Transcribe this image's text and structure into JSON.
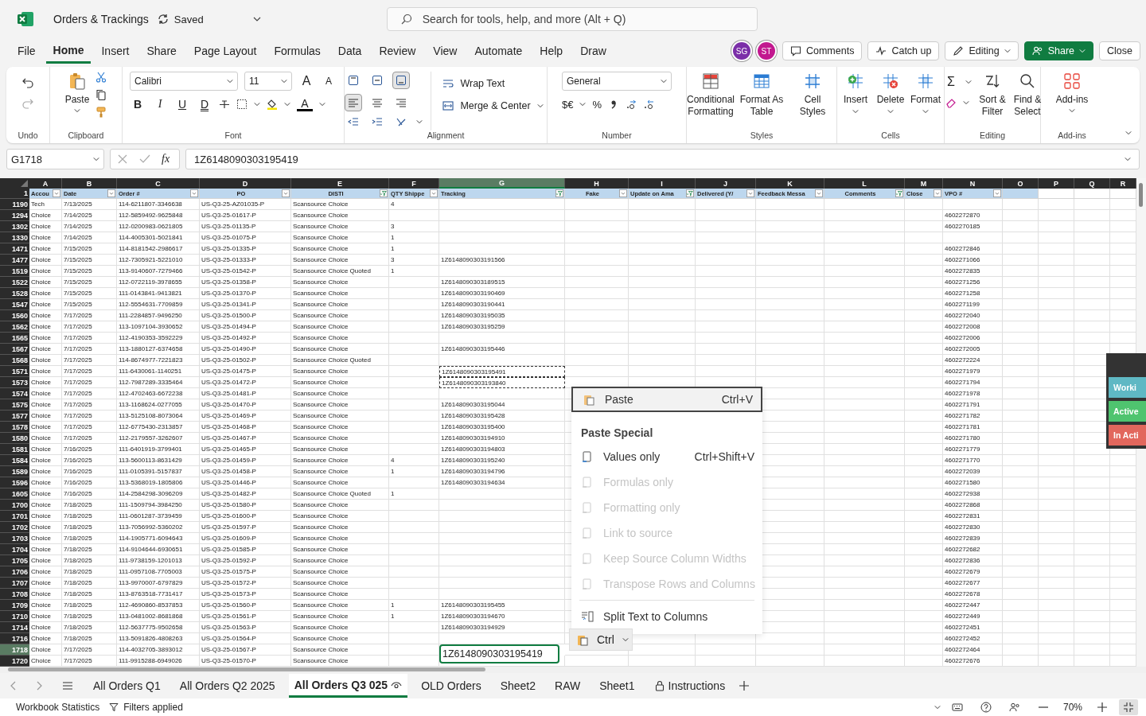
{
  "titlebar": {
    "title": "Orders & Trackings",
    "status": "Saved",
    "search": {
      "placeholder": "Search for tools, help, and more (Alt + Q)"
    }
  },
  "menu": [
    {
      "label": "File",
      "selected": false
    },
    {
      "label": "Home",
      "selected": true
    },
    {
      "label": "Insert",
      "selected": false
    },
    {
      "label": "Share",
      "selected": false
    },
    {
      "label": "Page Layout",
      "selected": false
    },
    {
      "label": "Formulas",
      "selected": false
    },
    {
      "label": "Data",
      "selected": false
    },
    {
      "label": "Review",
      "selected": false
    },
    {
      "label": "View",
      "selected": false
    },
    {
      "label": "Automate",
      "selected": false
    },
    {
      "label": "Help",
      "selected": false
    },
    {
      "label": "Draw",
      "selected": false
    }
  ],
  "avatars": [
    {
      "initials": "SG",
      "color": "#7b2fa8"
    },
    {
      "initials": "ST",
      "color": "#c2188f"
    }
  ],
  "actions": {
    "comments": "Comments",
    "catch_up": "Catch up",
    "mode": "Editing",
    "share": "Share",
    "close": "Close"
  },
  "ribbon": {
    "undo": {
      "label": "Undo"
    },
    "clipboard": {
      "label": "Clipboard",
      "paste": "Paste"
    },
    "font": {
      "label": "Font",
      "family": "Calibri",
      "size": "11",
      "grow": "A",
      "shrink": "A",
      "styles": [
        "B",
        "I",
        "U",
        "D"
      ],
      "color_letter": "A"
    },
    "alignment": {
      "label": "Alignment",
      "vertical": [
        {
          "selected": false
        },
        {
          "selected": false
        },
        {
          "selected": true
        }
      ],
      "horizontal": [
        {
          "selected": true
        },
        {
          "selected": false
        },
        {
          "selected": false
        }
      ],
      "wrap": "Wrap Text",
      "merge": "Merge & Center"
    },
    "number": {
      "label": "Number",
      "format": "General",
      "currency": "$€",
      "percent": "%"
    },
    "styles": {
      "label": "Styles",
      "buttons": [
        "Conditional Formatting",
        "Format As Table",
        "Cell Styles"
      ]
    },
    "cells": {
      "label": "Cells",
      "buttons": [
        "Insert",
        "Delete",
        "Format"
      ]
    },
    "editing": {
      "label": "Editing",
      "sum": "Σ",
      "buttons": [
        "Sort & Filter",
        "Find & Select"
      ]
    },
    "addins": {
      "label": "Add-ins",
      "button": "Add-ins"
    }
  },
  "formula_bar": {
    "name_box": "G1718",
    "fx": "fx",
    "value": "1Z6148090303195419"
  },
  "sheet": {
    "header_row": "1",
    "columns": [
      {
        "letter": "A",
        "label": "Accou",
        "filtered": false,
        "selected": false
      },
      {
        "letter": "B",
        "label": "Date",
        "filtered": false,
        "selected": false
      },
      {
        "letter": "C",
        "label": "Order #",
        "filtered": false,
        "selected": false
      },
      {
        "letter": "D",
        "label": "PO",
        "filtered": false,
        "selected": false
      },
      {
        "letter": "E",
        "label": "DISTI",
        "filtered": true,
        "selected": false
      },
      {
        "letter": "F",
        "label": "QTY Shippe",
        "filtered": false,
        "selected": false
      },
      {
        "letter": "G",
        "label": "Tracking",
        "filtered": true,
        "selected": true
      },
      {
        "letter": "H",
        "label": "Fake",
        "filtered": false,
        "selected": false
      },
      {
        "letter": "I",
        "label": "Update on Ama",
        "filtered": true,
        "selected": false
      },
      {
        "letter": "J",
        "label": "Delivered (Y/",
        "filtered": false,
        "selected": false
      },
      {
        "letter": "K",
        "label": "Feedback Messa",
        "filtered": false,
        "selected": false
      },
      {
        "letter": "L",
        "label": "Comments",
        "filtered": true,
        "selected": false
      },
      {
        "letter": "M",
        "label": "Close",
        "filtered": false,
        "selected": false
      },
      {
        "letter": "N",
        "label": "VPO #",
        "filtered": false,
        "selected": false
      },
      {
        "letter": "O",
        "selected": false
      },
      {
        "letter": "P",
        "selected": false
      },
      {
        "letter": "Q",
        "selected": false
      },
      {
        "letter": "R",
        "selected": false
      }
    ],
    "rows": [
      {
        "row": "1190",
        "account": "Tech",
        "date": "7/13/2025",
        "order": "114-6211807-3346638",
        "po": "US-Q3-25-AZ01035-P",
        "disti": "Scansource Choice",
        "qty": "4",
        "selected": false,
        "copied": false
      },
      {
        "row": "1294",
        "account": "Choice",
        "date": "7/14/2025",
        "order": "112-5859492-9625848",
        "po": "US-Q3-25-01617-P",
        "disti": "Scansource Choice",
        "vpo": "4602272870",
        "selected": false,
        "copied": false
      },
      {
        "row": "1302",
        "account": "Choice",
        "date": "7/14/2025",
        "order": "112-0200983-0621805",
        "po": "US-Q3-25-01135-P",
        "disti": "Scansource Choice",
        "qty": "3",
        "vpo": "4602270185",
        "selected": false,
        "copied": false
      },
      {
        "row": "1330",
        "account": "Choice",
        "date": "7/14/2025",
        "order": "114-4005301-5021841",
        "po": "US-Q3-25-01075-P",
        "disti": "Scansource Choice",
        "qty": "1",
        "selected": false,
        "copied": false
      },
      {
        "row": "1471",
        "account": "Choice",
        "date": "7/15/2025",
        "order": "114-8181542-2986617",
        "po": "US-Q3-25-01335-P",
        "disti": "Scansource Choice",
        "qty": "1",
        "vpo": "4602272846",
        "selected": false,
        "copied": false
      },
      {
        "row": "1477",
        "account": "Choice",
        "date": "7/15/2025",
        "order": "112-7305921-5221010",
        "po": "US-Q3-25-01333-P",
        "disti": "Scansource Choice",
        "qty": "3",
        "tracking": "1Z6148090303191566",
        "vpo": "4602271066",
        "selected": false,
        "copied": false
      },
      {
        "row": "1519",
        "account": "Choice",
        "date": "7/15/2025",
        "order": "113-9140607-7279466",
        "po": "US-Q3-25-01542-P",
        "disti": "Scansource Choice Quoted",
        "qty": "1",
        "vpo": "4602272835",
        "selected": false,
        "copied": false
      },
      {
        "row": "1522",
        "account": "Choice",
        "date": "7/15/2025",
        "order": "112-0722119-3978655",
        "po": "US-Q3-25-01358-P",
        "disti": "Scansource Choice",
        "tracking": "1Z6148090303189515",
        "vpo": "4602271256",
        "selected": false,
        "copied": false
      },
      {
        "row": "1528",
        "account": "Choice",
        "date": "7/15/2025",
        "order": "111-0143841-9413821",
        "po": "US-Q3-25-01370-P",
        "disti": "Scansource Choice",
        "tracking": "1Z6148090303190469",
        "vpo": "4602271258",
        "selected": false,
        "copied": false
      },
      {
        "row": "1547",
        "account": "Choice",
        "date": "7/15/2025",
        "order": "112-5554631-7709859",
        "po": "US-Q3-25-01341-P",
        "disti": "Scansource Choice",
        "tracking": "1Z6148090303190441",
        "vpo": "4602271199",
        "selected": false,
        "copied": false
      },
      {
        "row": "1560",
        "account": "Choice",
        "date": "7/17/2025",
        "order": "111-2284857-9496250",
        "po": "US-Q3-25-01500-P",
        "disti": "Scansource Choice",
        "tracking": "1Z6148090303195035",
        "vpo": "4602272040",
        "selected": false,
        "copied": false
      },
      {
        "row": "1562",
        "account": "Choice",
        "date": "7/17/2025",
        "order": "113-1097104-3930652",
        "po": "US-Q3-25-01494-P",
        "disti": "Scansource Choice",
        "tracking": "1Z6148090303195259",
        "vpo": "4602272008",
        "selected": false,
        "copied": false
      },
      {
        "row": "1565",
        "account": "Choice",
        "date": "7/17/2025",
        "order": "112-4190353-3592229",
        "po": "US-Q3-25-01492-P",
        "disti": "Scansource Choice",
        "vpo": "4602272006",
        "selected": false,
        "copied": false
      },
      {
        "row": "1567",
        "account": "Choice",
        "date": "7/17/2025",
        "order": "113-1880127-6374658",
        "po": "US-Q3-25-01490-P",
        "disti": "Scansource Choice",
        "tracking": "1Z6148090303195446",
        "vpo": "4602272005",
        "selected": false,
        "copied": false
      },
      {
        "row": "1568",
        "account": "Choice",
        "date": "7/17/2025",
        "order": "114-8674977-7221823",
        "po": "US-Q3-25-01502-P",
        "disti": "Scansource Choice Quoted",
        "vpo": "4602272224",
        "selected": false,
        "copied": false
      },
      {
        "row": "1571",
        "account": "Choice",
        "date": "7/17/2025",
        "order": "111-6430061-1140251",
        "po": "US-Q3-25-01475-P",
        "disti": "Scansource Choice",
        "tracking": "1Z6148090303195491",
        "vpo": "4602271979",
        "selected": false,
        "copied": true
      },
      {
        "row": "1573",
        "account": "Choice",
        "date": "7/17/2025",
        "order": "112-7987289-3335464",
        "po": "US-Q3-25-01472-P",
        "disti": "Scansource Choice",
        "tracking": "1Z6148090303193840",
        "vpo": "4602271794",
        "selected": false,
        "copied": true
      },
      {
        "row": "1574",
        "account": "Choice",
        "date": "7/17/2025",
        "order": "112-4702463-6672238",
        "po": "US-Q3-25-01481-P",
        "disti": "Scansource Choice",
        "vpo": "4602271978",
        "selected": false,
        "copied": false
      },
      {
        "row": "1575",
        "account": "Choice",
        "date": "7/17/2025",
        "order": "113-1168624-0277055",
        "po": "US-Q3-25-01470-P",
        "disti": "Scansource Choice",
        "tracking": "1Z6148090303195044",
        "vpo": "4602271791",
        "selected": false,
        "copied": false
      },
      {
        "row": "1577",
        "account": "Choice",
        "date": "7/17/2025",
        "order": "113-5125108-8073064",
        "po": "US-Q3-25-01469-P",
        "disti": "Scansource Choice",
        "tracking": "1Z6148090303195428",
        "vpo": "4602271782",
        "selected": false,
        "copied": false
      },
      {
        "row": "1578",
        "account": "Choice",
        "date": "7/17/2025",
        "order": "112-6775430-2313857",
        "po": "US-Q3-25-01468-P",
        "disti": "Scansource Choice",
        "tracking": "1Z6148090303195400",
        "vpo": "4602271781",
        "selected": false,
        "copied": false
      },
      {
        "row": "1580",
        "account": "Choice",
        "date": "7/17/2025",
        "order": "112-2179557-3262607",
        "po": "US-Q3-25-01467-P",
        "disti": "Scansource Choice",
        "tracking": "1Z6148090303194910",
        "vpo": "4602271780",
        "selected": false,
        "copied": false
      },
      {
        "row": "1581",
        "account": "Choice",
        "date": "7/16/2025",
        "order": "111-6401919-3799401",
        "po": "US-Q3-25-01465-P",
        "disti": "Scansource Choice",
        "tracking": "1Z6148090303194803",
        "vpo": "4602271779",
        "selected": false,
        "copied": false
      },
      {
        "row": "1584",
        "account": "Choice",
        "date": "7/16/2025",
        "order": "113-5600113-8631429",
        "po": "US-Q3-25-01459-P",
        "disti": "Scansource Choice",
        "qty": "4",
        "tracking": "1Z6148090303195240",
        "vpo": "4602271770",
        "selected": false,
        "copied": false
      },
      {
        "row": "1589",
        "account": "Choice",
        "date": "7/16/2025",
        "order": "111-0105391-5157837",
        "po": "US-Q3-25-01458-P",
        "disti": "Scansource Choice",
        "qty": "1",
        "tracking": "1Z6148090303194796",
        "vpo": "4602272039",
        "selected": false,
        "copied": false
      },
      {
        "row": "1596",
        "account": "Choice",
        "date": "7/16/2025",
        "order": "113-5368019-1805806",
        "po": "US-Q3-25-01446-P",
        "disti": "Scansource Choice",
        "tracking": "1Z6148090303194634",
        "vpo": "4602271580",
        "selected": false,
        "copied": false
      },
      {
        "row": "1605",
        "account": "Choice",
        "date": "7/16/2025",
        "order": "114-2584298-3096209",
        "po": "US-Q3-25-01482-P",
        "disti": "Scansource Choice Quoted",
        "qty": "1",
        "vpo": "4602272938",
        "selected": false,
        "copied": false
      },
      {
        "row": "1700",
        "account": "Choice",
        "date": "7/18/2025",
        "order": "111-1509794-3984250",
        "po": "US-Q3-25-01580-P",
        "disti": "Scansource Choice",
        "vpo": "4602272868",
        "selected": false,
        "copied": false
      },
      {
        "row": "1701",
        "account": "Choice",
        "date": "7/18/2025",
        "order": "111-0601287-3739459",
        "po": "US-Q3-25-01600-P",
        "disti": "Scansource Choice",
        "vpo": "4602272831",
        "selected": false,
        "copied": false
      },
      {
        "row": "1702",
        "account": "Choice",
        "date": "7/18/2025",
        "order": "113-7056992-5360202",
        "po": "US-Q3-25-01597-P",
        "disti": "Scansource Choice",
        "vpo": "4602272830",
        "selected": false,
        "copied": false
      },
      {
        "row": "1703",
        "account": "Choice",
        "date": "7/18/2025",
        "order": "114-1905771-6094643",
        "po": "US-Q3-25-01609-P",
        "disti": "Scansource Choice",
        "vpo": "4602272839",
        "selected": false,
        "copied": false
      },
      {
        "row": "1704",
        "account": "Choice",
        "date": "7/18/2025",
        "order": "114-9104644-6930651",
        "po": "US-Q3-25-01585-P",
        "disti": "Scansource Choice",
        "vpo": "4602272682",
        "selected": false,
        "copied": false
      },
      {
        "row": "1705",
        "account": "Choice",
        "date": "7/18/2025",
        "order": "111-9738159-1201013",
        "po": "US-Q3-25-01592-P",
        "disti": "Scansource Choice",
        "vpo": "4602272836",
        "selected": false,
        "copied": false
      },
      {
        "row": "1706",
        "account": "Choice",
        "date": "7/18/2025",
        "order": "111-0957108-7705003",
        "po": "US-Q3-25-01575-P",
        "disti": "Scansource Choice",
        "vpo": "4602272679",
        "selected": false,
        "copied": false
      },
      {
        "row": "1707",
        "account": "Choice",
        "date": "7/18/2025",
        "order": "113-9970007-6797829",
        "po": "US-Q3-25-01572-P",
        "disti": "Scansource Choice",
        "vpo": "4602272677",
        "selected": false,
        "copied": false
      },
      {
        "row": "1708",
        "account": "Choice",
        "date": "7/18/2025",
        "order": "113-8763518-7731417",
        "po": "US-Q3-25-01573-P",
        "disti": "Scansource Choice",
        "vpo": "4602272678",
        "selected": false,
        "copied": false
      },
      {
        "row": "1709",
        "account": "Choice",
        "date": "7/18/2025",
        "order": "112-4690860-8537853",
        "po": "US-Q3-25-01560-P",
        "disti": "Scansource Choice",
        "qty": "1",
        "tracking": "1Z6148090303195455",
        "vpo": "4602272447",
        "selected": false,
        "copied": false
      },
      {
        "row": "1710",
        "account": "Choice",
        "date": "7/18/2025",
        "order": "113-0481002-8681868",
        "po": "US-Q3-25-01561-P",
        "disti": "Scansource Choice",
        "qty": "1",
        "tracking": "1Z6148090303194670",
        "vpo": "4602272449",
        "selected": false,
        "copied": false
      },
      {
        "row": "1714",
        "account": "Choice",
        "date": "7/18/2025",
        "order": "112-5637775-9502658",
        "po": "US-Q3-25-01563-P",
        "disti": "Scansource Choice",
        "tracking": "1Z6148090303194929",
        "vpo": "4602272451",
        "selected": false,
        "copied": false
      },
      {
        "row": "1716",
        "account": "Choice",
        "date": "7/18/2025",
        "order": "113-5091826-4808263",
        "po": "US-Q3-25-01564-P",
        "disti": "Scansource Choice",
        "vpo": "4602272452",
        "selected": false,
        "copied": false
      },
      {
        "row": "1718",
        "account": "Choice",
        "date": "7/17/2025",
        "order": "114-4032705-3893012",
        "po": "US-Q3-25-01567-P",
        "disti": "Scansource Choice",
        "tracking": "1Z6148090303195419",
        "vpo": "4602272464",
        "selected": true,
        "copied": false
      },
      {
        "row": "1720",
        "account": "Choice",
        "date": "7/17/2025",
        "order": "111-9915288-6949026",
        "po": "US-Q3-25-01570-P",
        "disti": "Scansource Choice",
        "vpo": "4602272676",
        "selected": false,
        "copied": false
      }
    ]
  },
  "context_menu": {
    "paste": {
      "label": "Paste",
      "shortcut": "Ctrl+V"
    },
    "section": "Paste Special",
    "items": [
      {
        "label": "Values only",
        "shortcut": "Ctrl+Shift+V",
        "disabled": false
      },
      {
        "label": "Formulas only",
        "disabled": true
      },
      {
        "label": "Formatting only",
        "disabled": true
      },
      {
        "label": "Link to source",
        "disabled": true
      },
      {
        "label": "Keep Source Column Widths",
        "disabled": true
      },
      {
        "label": "Transpose Rows and Columns",
        "disabled": true
      }
    ],
    "split": {
      "label": "Split Text to Columns"
    }
  },
  "paste_options": {
    "label": "Ctrl"
  },
  "status_panel": [
    {
      "label": "Worki",
      "color": "#5fb8c4"
    },
    {
      "label": "Active",
      "color": "#4fc46f"
    },
    {
      "label": "In Acti",
      "color": "#e2675d"
    }
  ],
  "sheet_tabs": [
    {
      "label": "All Orders Q1",
      "selected": false,
      "locked": false
    },
    {
      "label": "All Orders Q2 2025",
      "selected": false,
      "locked": false
    },
    {
      "label": "All Orders Q3 025",
      "selected": true,
      "locked": false
    },
    {
      "label": "OLD Orders",
      "selected": false,
      "locked": false
    },
    {
      "label": "Sheet2",
      "selected": false,
      "locked": false
    },
    {
      "label": "RAW",
      "selected": false,
      "locked": false
    },
    {
      "label": "Sheet1",
      "selected": false,
      "locked": false
    },
    {
      "label": "Instructions",
      "selected": false,
      "locked": true
    }
  ],
  "status_bar": {
    "statistics": "Workbook Statistics",
    "filters": "Filters applied",
    "zoom": "70%"
  }
}
